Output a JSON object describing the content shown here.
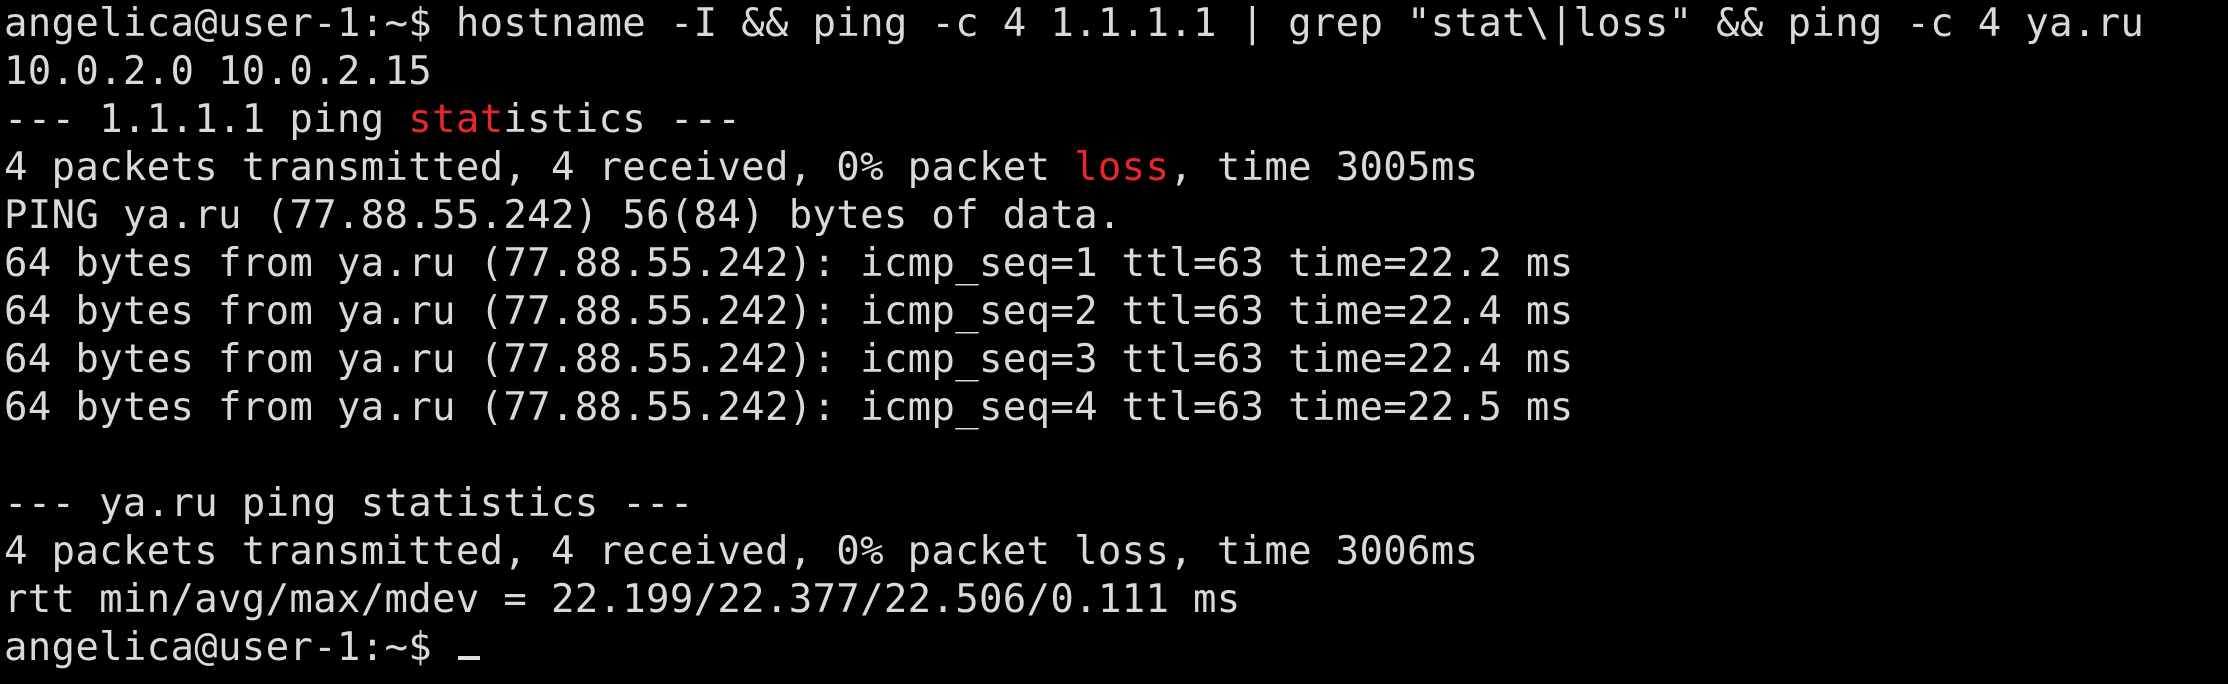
{
  "terminal": {
    "prompt_user": "angelica@user-1:~$",
    "command": "hostname -I && ping -c 4 1.1.1.1 | grep \"stat\\|loss\" && ping -c 4 ya.ru",
    "colors": {
      "background": "#000000",
      "foreground": "#d9d9d9",
      "grep_match": "#e8262d"
    },
    "output": {
      "ip_addresses": "10.0.2.0 10.0.2.15",
      "stats1_pre": "--- 1.1.1.1 ping ",
      "stats1_match": "stat",
      "stats1_post": "istics ---",
      "summary1_pre": "4 packets transmitted, 4 received, 0% packet ",
      "summary1_match": "loss",
      "summary1_post": ", time 3005ms",
      "ping_header": "PING ya.ru (77.88.55.242) 56(84) bytes of data.",
      "reply1": "64 bytes from ya.ru (77.88.55.242): icmp_seq=1 ttl=63 time=22.2 ms",
      "reply2": "64 bytes from ya.ru (77.88.55.242): icmp_seq=2 ttl=63 time=22.4 ms",
      "reply3": "64 bytes from ya.ru (77.88.55.242): icmp_seq=3 ttl=63 time=22.4 ms",
      "reply4": "64 bytes from ya.ru (77.88.55.242): icmp_seq=4 ttl=63 time=22.5 ms",
      "stats2": "--- ya.ru ping statistics ---",
      "summary2": "4 packets transmitted, 4 received, 0% packet loss, time 3006ms",
      "rtt": "rtt min/avg/max/mdev = 22.199/22.377/22.506/0.111 ms"
    },
    "final_prompt": "angelica@user-1:~$"
  }
}
